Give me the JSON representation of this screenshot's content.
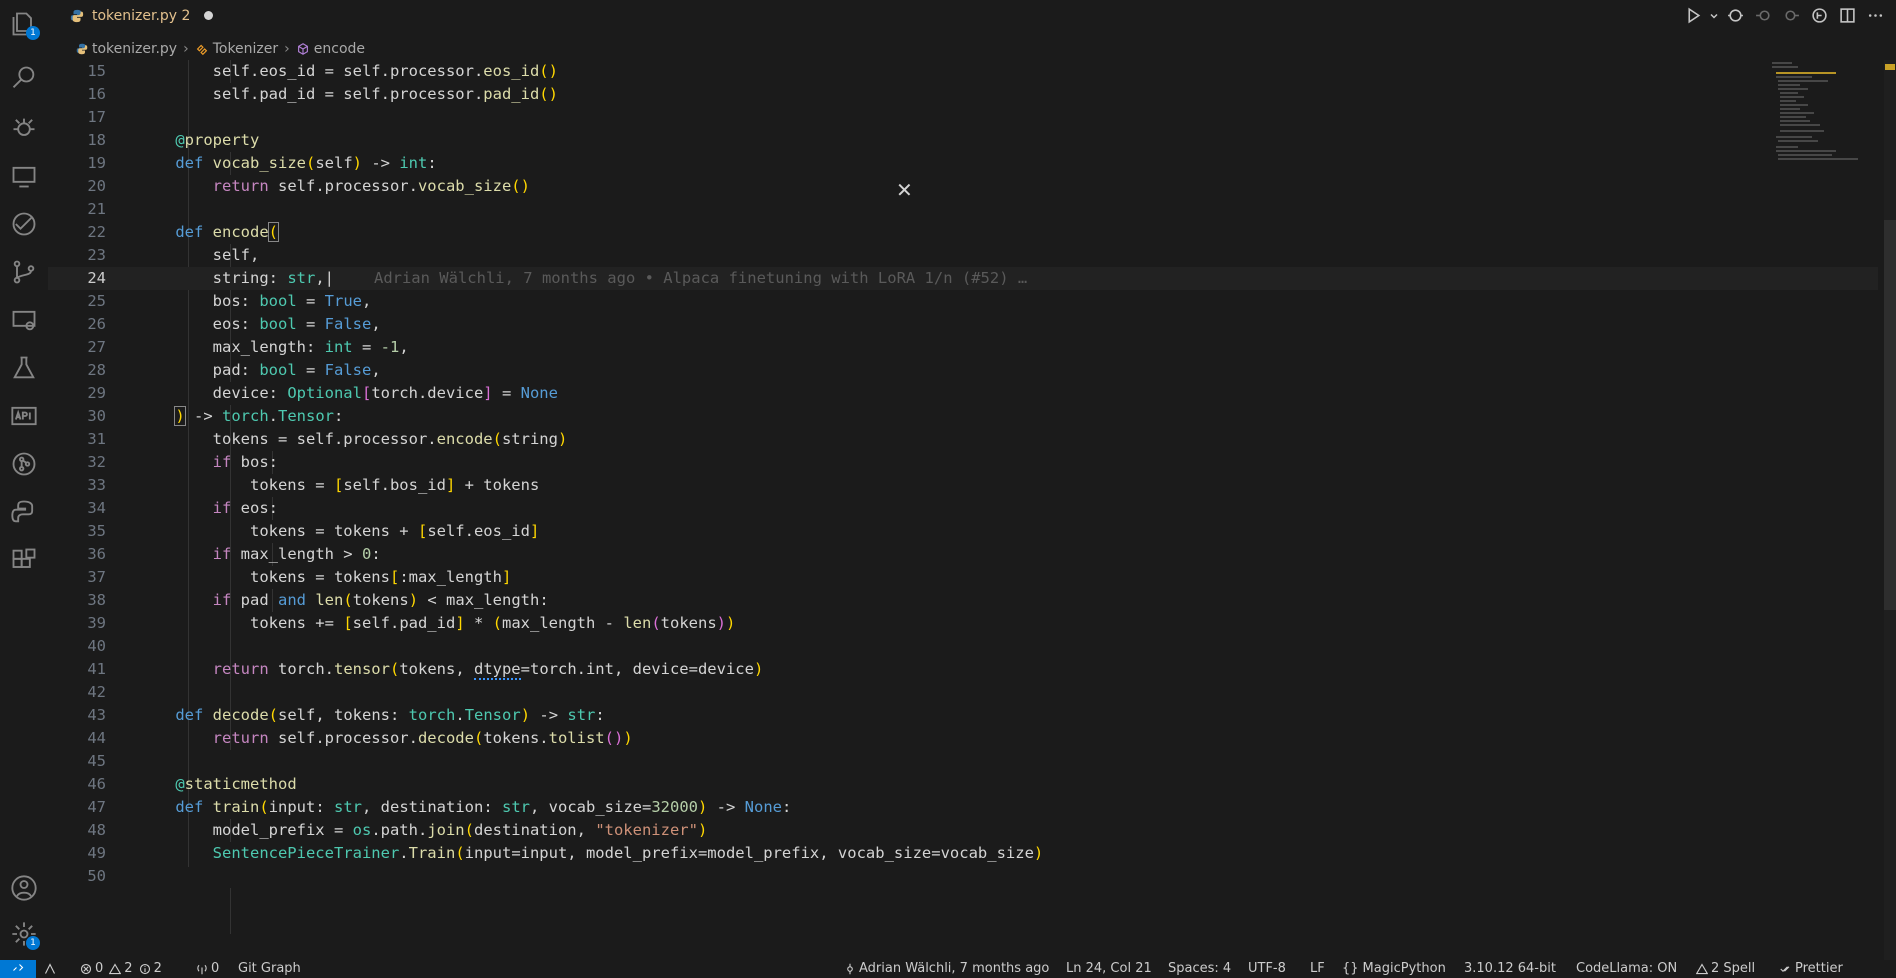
{
  "tab": {
    "title": "tokenizer.py 2"
  },
  "activity": {
    "explorer_badge": "1",
    "settings_badge": "1"
  },
  "breadcrumb": [
    "tokenizer.py",
    "Tokenizer",
    "encode"
  ],
  "editor": {
    "current_line": 24,
    "blame": "Adrian Wälchli, 7 months ago • Alpaca finetuning with LoRA 1/n (#52) …",
    "line_numbers": [
      "15",
      "16",
      "17",
      "18",
      "19",
      "20",
      "21",
      "22",
      "23",
      "24",
      "25",
      "26",
      "27",
      "28",
      "29",
      "30",
      "31",
      "32",
      "33",
      "34",
      "35",
      "36",
      "37",
      "38",
      "39",
      "40",
      "41",
      "42",
      "43",
      "44",
      "45",
      "46",
      "47",
      "48",
      "49",
      "50"
    ]
  },
  "status": {
    "problems_errors": "0",
    "problems_warnings": "2",
    "info": "2",
    "ports": "0",
    "git_graph": "Git Graph",
    "blame": "Adrian Wälchli, 7 months ago",
    "position": "Ln 24, Col 21",
    "spaces": "Spaces: 4",
    "encoding": "UTF-8",
    "eol": "LF",
    "language": "MagicPython",
    "interpreter": "3.10.12 64-bit",
    "codellama": "CodeLlama: ON",
    "spell": "2 Spell",
    "prettier": "Prettier"
  },
  "colors": {
    "accent": "#0078d4",
    "tab_title": "#e2c08d",
    "background": "#1b1b1b"
  }
}
